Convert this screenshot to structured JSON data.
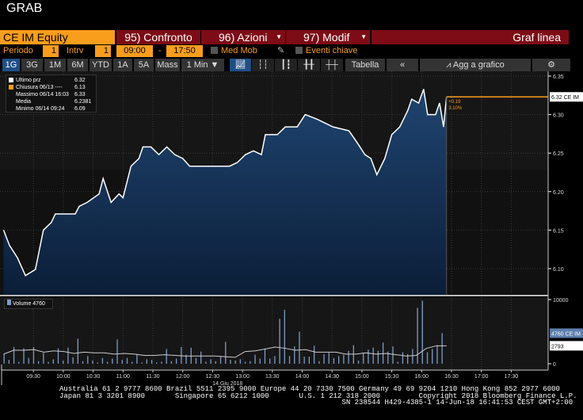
{
  "title": "GRAB",
  "header": {
    "ticker": "CE IM Equity",
    "compare": "95) Confronto",
    "actions": "96) Azioni",
    "modify": "97) Modif",
    "chart_type": "Graf linea"
  },
  "controls": {
    "period_label": "Periodo",
    "period_value": "1",
    "interval_label": "Intrv",
    "interval_value": "1",
    "start_time": "09:00",
    "dash": "-",
    "end_time": "17:50",
    "moving_avg": "Med Mob",
    "key_events": "Eventi chiave"
  },
  "toolbar": {
    "ranges": [
      "1G",
      "3G",
      "1M",
      "6M",
      "YTD",
      "1A",
      "5A",
      "Mass"
    ],
    "interval": "1 Min ▼",
    "table": "Tabella",
    "collapse": "«",
    "add_to_chart": "Agg a grafico"
  },
  "legend": [
    {
      "label": "Ultimo prz",
      "value": "6.32",
      "color": "#ffffff"
    },
    {
      "label": "Chiusura 06/13 ----",
      "value": "6.13",
      "color": "#f99d1c"
    },
    {
      "label": "Massimo 06/14 16:03",
      "value": "6.33"
    },
    {
      "label": "Media",
      "value": "6.2381"
    },
    {
      "label": "Minimo 06/14 09:24",
      "value": "6.09"
    }
  ],
  "change": {
    "abs": "+0.19",
    "pct": "3.10%"
  },
  "last_tag": "6.32 CE IM",
  "volume_legend": "Volume 4760",
  "volume_tag": "4760 CE IM",
  "volume_ma_tag": "2793",
  "date_label": "14 Giu 2018",
  "footer": {
    "line1": "Australia 61 2 9777 8600 Brazil 5511 2395 9000 Europe 44 20 7330 7500 Germany 49 69 9204 1210 Hong Kong 852 2977 6000",
    "line2": "Japan 81 3 3201 8900       Singapore 65 6212 1000       U.S. 1 212 318 2000         Copyright 2018 Bloomberg Finance L.P.",
    "line3": "                                                                  SN 238544 H429-4385-1 14-Jun-18 16:41:53 CEST GMT+2:00"
  },
  "chart_data": {
    "type": "line",
    "price_ticks": [
      "6.35",
      "6.30",
      "6.25",
      "6.20",
      "6.15",
      "6.10"
    ],
    "ylim": [
      6.06,
      6.356
    ],
    "time_ticks": [
      "09:30",
      "10:00",
      "10:30",
      "11:00",
      "11:30",
      "12:00",
      "12:30",
      "13:00",
      "13:30",
      "14:00",
      "14:30",
      "15:00",
      "15:30",
      "16:00",
      "16:30",
      "17:00",
      "17:30"
    ],
    "x_minutes_from_0900": [
      0,
      450,
      500
    ],
    "price": [
      [
        0,
        6.15
      ],
      [
        6,
        6.13
      ],
      [
        14,
        6.114
      ],
      [
        22,
        6.091
      ],
      [
        32,
        6.099
      ],
      [
        40,
        6.15
      ],
      [
        48,
        6.16
      ],
      [
        52,
        6.171
      ],
      [
        72,
        6.171
      ],
      [
        76,
        6.181
      ],
      [
        84,
        6.186
      ],
      [
        96,
        6.197
      ],
      [
        100,
        6.217
      ],
      [
        108,
        6.186
      ],
      [
        116,
        6.197
      ],
      [
        120,
        6.192
      ],
      [
        128,
        6.233
      ],
      [
        136,
        6.243
      ],
      [
        140,
        6.258
      ],
      [
        148,
        6.258
      ],
      [
        156,
        6.248
      ],
      [
        164,
        6.258
      ],
      [
        172,
        6.248
      ],
      [
        180,
        6.243
      ],
      [
        187,
        6.233
      ],
      [
        227,
        6.233
      ],
      [
        235,
        6.238
      ],
      [
        243,
        6.248
      ],
      [
        251,
        6.253
      ],
      [
        259,
        6.248
      ],
      [
        263,
        6.274
      ],
      [
        275,
        6.274
      ],
      [
        283,
        6.284
      ],
      [
        295,
        6.284
      ],
      [
        303,
        6.3
      ],
      [
        315,
        6.294
      ],
      [
        323,
        6.289
      ],
      [
        331,
        6.284
      ],
      [
        347,
        6.279
      ],
      [
        355,
        6.264
      ],
      [
        363,
        6.248
      ],
      [
        369,
        6.243
      ],
      [
        375,
        6.222
      ],
      [
        383,
        6.243
      ],
      [
        390,
        6.274
      ],
      [
        398,
        6.284
      ],
      [
        406,
        6.305
      ],
      [
        410,
        6.32
      ],
      [
        417,
        6.315
      ],
      [
        422,
        6.333
      ],
      [
        426,
        6.3
      ],
      [
        434,
        6.3
      ],
      [
        438,
        6.315
      ],
      [
        442,
        6.284
      ],
      [
        445,
        6.323
      ],
      [
        500,
        6.323
      ]
    ],
    "volume_ticks": [
      "10000",
      "0"
    ],
    "volume_ylim": [
      0,
      10000
    ],
    "volume": [
      1500,
      600,
      2600,
      300,
      2400,
      900,
      2600,
      400,
      1700,
      300,
      700,
      2400,
      500,
      2500,
      1000,
      3900,
      400,
      1200,
      500,
      200,
      900,
      300,
      800,
      3800,
      600,
      900,
      300,
      1500,
      200,
      700,
      600,
      200,
      300,
      2300,
      400,
      800,
      2600,
      1400,
      2500,
      900,
      1900,
      300,
      700,
      400,
      1100,
      3400,
      600,
      500,
      700,
      300,
      400,
      1400,
      800,
      2300,
      800,
      1200,
      7000,
      8400,
      1200,
      2700,
      5000,
      1100,
      1100,
      2800,
      400,
      1500,
      1700,
      900,
      1200,
      1400,
      2000,
      2900,
      500,
      1700,
      2200,
      2500,
      2000,
      3300,
      1900,
      2700,
      300,
      1800,
      1500,
      2300,
      8700,
      9800,
      1800,
      2300,
      2900,
      4760
    ],
    "volume_ma": [
      1500,
      2100,
      2100,
      2200,
      1800,
      2000,
      1900,
      1600,
      1800,
      1700,
      1700,
      1500,
      1600,
      1500,
      1300,
      1300,
      1400,
      1300,
      1200,
      1200,
      1200,
      1200,
      1100,
      1000,
      1900,
      2000,
      2300,
      2600,
      2400,
      2100,
      2200,
      1800,
      1800,
      1800,
      1500,
      1500,
      1700,
      1500,
      1600,
      1400,
      1200,
      1300,
      2400,
      2800,
      2793
    ]
  }
}
